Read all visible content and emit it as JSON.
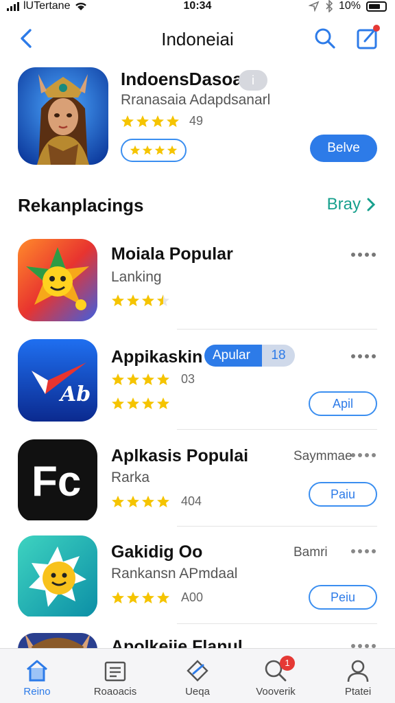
{
  "status_bar": {
    "carrier": "lUTertane",
    "time": "10:34",
    "battery": "10%"
  },
  "nav": {
    "title": "Indoneiai"
  },
  "featured": {
    "name": "IndoensDasoa",
    "badge": "i",
    "subtitle": "Rranasaia Adapdsanarl",
    "rating_count": "49",
    "rating": 4,
    "get_label": "Belve"
  },
  "section": {
    "title": "Rekanplacings",
    "link": "Bray"
  },
  "apps": [
    {
      "name": "Moiala Popular",
      "subtitle": "Lanking",
      "rating": 3.5
    },
    {
      "name": "Appikaskin",
      "tag_label": "Apular",
      "tag_value": "18",
      "rating_count": "03",
      "rating": 4,
      "rating_secondary": 4,
      "button": "Apil"
    },
    {
      "name": "Aplkasis Populai",
      "subtitle": "Rarka",
      "right_label": "Saymmae",
      "rating_count": "404",
      "rating": 4,
      "button": "Paiu"
    },
    {
      "name": "Gakidig Oo",
      "subtitle": "Rankansn APmdaal",
      "right_label": "Bamri",
      "rating_count": "A00",
      "rating": 4,
      "button": "Peiu"
    },
    {
      "name": "Apolkeiie Flanul"
    }
  ],
  "tabs": [
    {
      "label": "Reino",
      "icon": "home-icon",
      "active": true
    },
    {
      "label": "Roaoacis",
      "icon": "news-icon"
    },
    {
      "label": "Ueqa",
      "icon": "games-icon"
    },
    {
      "label": "Vooverik",
      "icon": "search-icon",
      "badge": "1"
    },
    {
      "label": "Ptatei",
      "icon": "person-icon"
    }
  ],
  "colors": {
    "accent": "#2d7be8",
    "link": "#17a08d",
    "star": "#f5c400",
    "badge": "#e53935"
  }
}
